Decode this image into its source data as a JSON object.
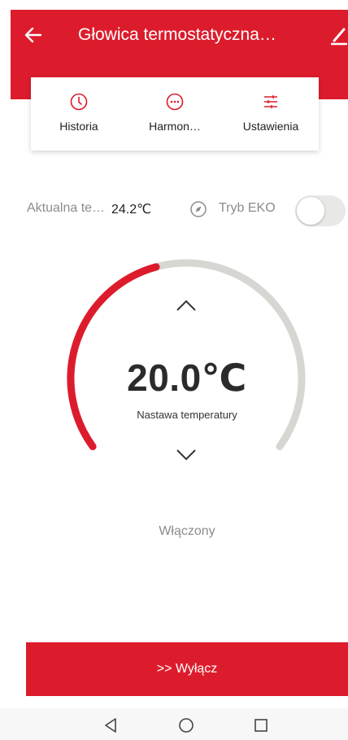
{
  "header": {
    "title": "Głowica termostatyczna…",
    "back_icon": "arrow-left-icon",
    "edit_icon": "pencil-icon"
  },
  "tabs": [
    {
      "label": "Historia",
      "icon": "clock-icon"
    },
    {
      "label": "Harmon…",
      "icon": "more-circle-icon"
    },
    {
      "label": "Ustawienia",
      "icon": "sliders-icon"
    }
  ],
  "info": {
    "current_temp_label": "Aktualna te…",
    "current_temp_value": "24.2℃",
    "eko_label": "Tryb EKO",
    "eko_enabled": false
  },
  "dial": {
    "setpoint": "20.0℃",
    "setpoint_label": "Nastawa temperatury",
    "fill_fraction": 0.44,
    "active_color": "#dc1c2c",
    "track_color": "#d6d6d2"
  },
  "status": "Włączony",
  "actions": {
    "off_button_label": ">> Wyłącz"
  },
  "colors": {
    "brand": "#dc1c2c"
  }
}
